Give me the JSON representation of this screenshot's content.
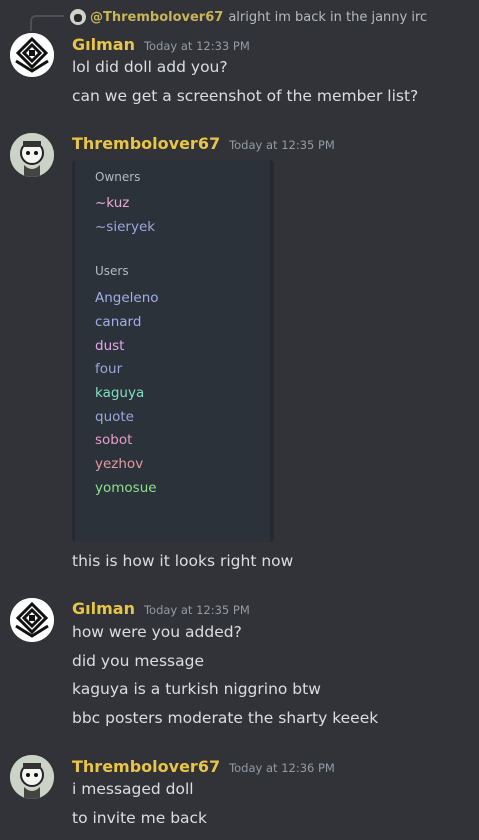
{
  "reply": {
    "author": "@Thrembolover67",
    "text": "alright im back in the janny irc"
  },
  "messages": [
    {
      "author": "Gılman",
      "timestamp": "Today at 12:33 PM",
      "lines": [
        "lol did doll add you?",
        "can we get a screenshot of the member list?"
      ]
    },
    {
      "author": "Thrembolover67",
      "timestamp": "Today at 12:35 PM",
      "lines": [
        "this is how it looks right now"
      ]
    },
    {
      "author": "Gılman",
      "timestamp": "Today at 12:35 PM",
      "lines": [
        "how were you added?",
        "did you message",
        "kaguya is a turkish niggrino btw",
        "bbc posters moderate the sharty keeek"
      ]
    },
    {
      "author": "Thrembolover67",
      "timestamp": "Today at 12:36 PM",
      "lines": [
        "i messaged doll",
        "to invite me back"
      ]
    }
  ],
  "screenshot": {
    "owners_label": "Owners",
    "owners": [
      {
        "name": "~kuz",
        "color": "#e7a9d8"
      },
      {
        "name": "~sieryek",
        "color": "#9aa7dd"
      }
    ],
    "users_label": "Users",
    "users": [
      {
        "name": "Angeleno",
        "color": "#a1aee8"
      },
      {
        "name": "canard",
        "color": "#a1aee8"
      },
      {
        "name": "dust",
        "color": "#e7a6e9"
      },
      {
        "name": "four",
        "color": "#9aa7dd"
      },
      {
        "name": "kaguya",
        "color": "#7fe0c0"
      },
      {
        "name": "quote",
        "color": "#9aa7dd"
      },
      {
        "name": "sobot",
        "color": "#e79ec7"
      },
      {
        "name": "yezhov",
        "color": "#e39aa0"
      },
      {
        "name": "yomosue",
        "color": "#8fe08f"
      }
    ]
  },
  "icons": {
    "gilman_avatar": "black-geometric-emblem-icon",
    "thremb_avatar": "cartoon-character-avatar-icon"
  }
}
